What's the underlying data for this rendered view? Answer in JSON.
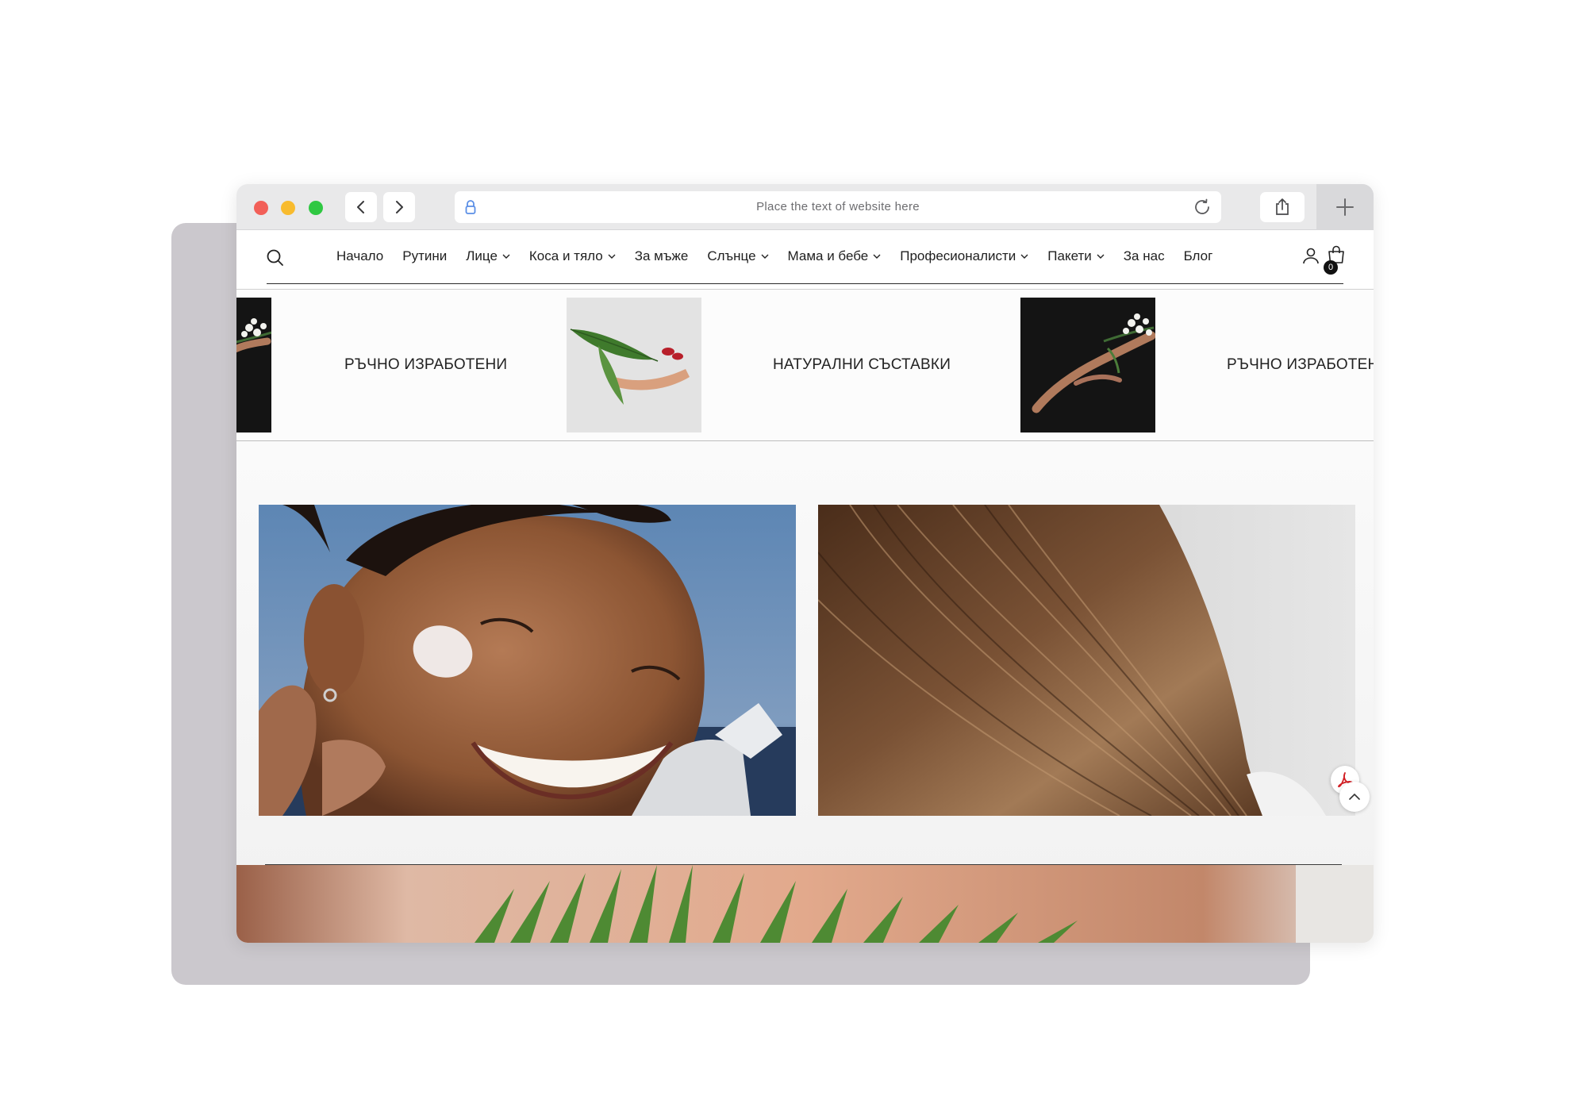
{
  "browser": {
    "address_placeholder": "Place the text of website here"
  },
  "site": {
    "menu": [
      {
        "label": "Начало",
        "has_dropdown": false
      },
      {
        "label": "Рутини",
        "has_dropdown": false
      },
      {
        "label": "Лице",
        "has_dropdown": true
      },
      {
        "label": "Коса и тяло",
        "has_dropdown": true
      },
      {
        "label": "За мъже",
        "has_dropdown": false
      },
      {
        "label": "Слънце",
        "has_dropdown": true
      },
      {
        "label": "Мама и бебе",
        "has_dropdown": true
      },
      {
        "label": "Професионалисти",
        "has_dropdown": true
      },
      {
        "label": "Пакети",
        "has_dropdown": true
      },
      {
        "label": "За нас",
        "has_dropdown": false
      },
      {
        "label": "Блог",
        "has_dropdown": false
      }
    ],
    "cart_count": "0"
  },
  "marquee": {
    "items": [
      "РЪЧНО ИЗРАБОТЕНИ",
      "НАТУРАЛНИ СЪСТАВКИ",
      "РЪЧНО ИЗРАБОТЕНИ"
    ]
  },
  "colors": {
    "close": "#f25f58",
    "minimize": "#f8bb2e",
    "zoom": "#2fc842",
    "pdf_red": "#d21f25"
  },
  "icons": [
    "chevron-left-icon",
    "chevron-right-icon",
    "lock-icon",
    "reload-icon",
    "share-icon",
    "plus-icon",
    "search-icon",
    "user-icon",
    "cart-icon",
    "pdf-icon",
    "chevron-up-icon"
  ]
}
